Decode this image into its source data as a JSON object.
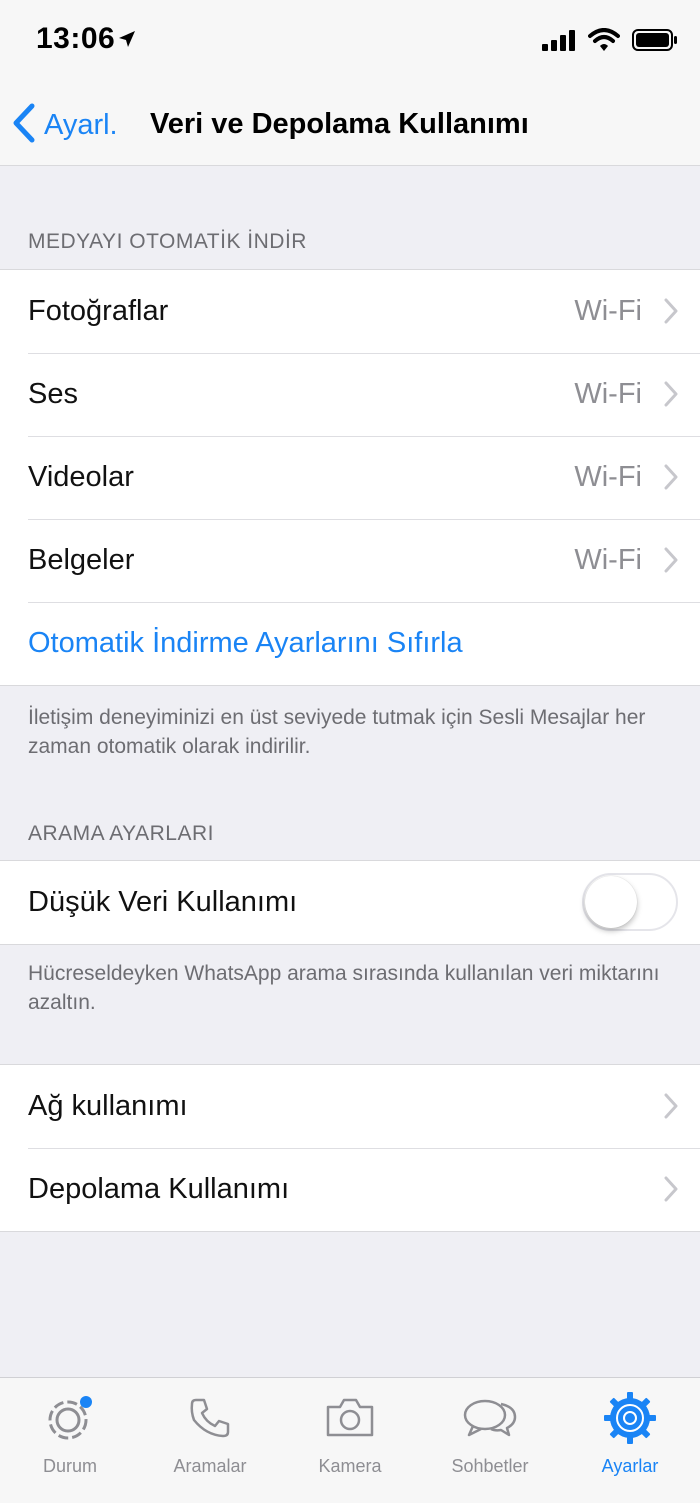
{
  "status_bar": {
    "time": "13:06"
  },
  "nav": {
    "back_label": "Ayarl.",
    "title": "Veri ve Depolama Kullanımı"
  },
  "auto_download": {
    "header": "MEDYAYI OTOMATİK İNDİR",
    "items": [
      {
        "label": "Fotoğraflar",
        "value": "Wi-Fi"
      },
      {
        "label": "Ses",
        "value": "Wi-Fi"
      },
      {
        "label": "Videolar",
        "value": "Wi-Fi"
      },
      {
        "label": "Belgeler",
        "value": "Wi-Fi"
      }
    ],
    "reset_label": "Otomatik İndirme Ayarlarını Sıfırla",
    "footnote": "İletişim deneyiminizi en üst seviyede tutmak için Sesli Mesajlar her zaman otomatik olarak indirilir."
  },
  "call_settings": {
    "header": "ARAMA AYARLARI",
    "low_data_label": "Düşük Veri Kullanımı",
    "low_data_enabled": false,
    "footnote": "Hücreseldeyken WhatsApp arama sırasında kullanılan veri miktarını azaltın."
  },
  "usage": {
    "items": [
      {
        "label": "Ağ kullanımı"
      },
      {
        "label": "Depolama Kullanımı"
      }
    ]
  },
  "tab_bar": {
    "tabs": [
      {
        "label": "Durum",
        "icon": "status-icon"
      },
      {
        "label": "Aramalar",
        "icon": "phone-icon"
      },
      {
        "label": "Kamera",
        "icon": "camera-icon"
      },
      {
        "label": "Sohbetler",
        "icon": "chats-icon"
      },
      {
        "label": "Ayarlar",
        "icon": "settings-gear-icon"
      }
    ],
    "active_index": 4
  },
  "colors": {
    "accent": "#1a84f5",
    "secondary_text": "#8e8e93",
    "background": "#efeff4"
  }
}
